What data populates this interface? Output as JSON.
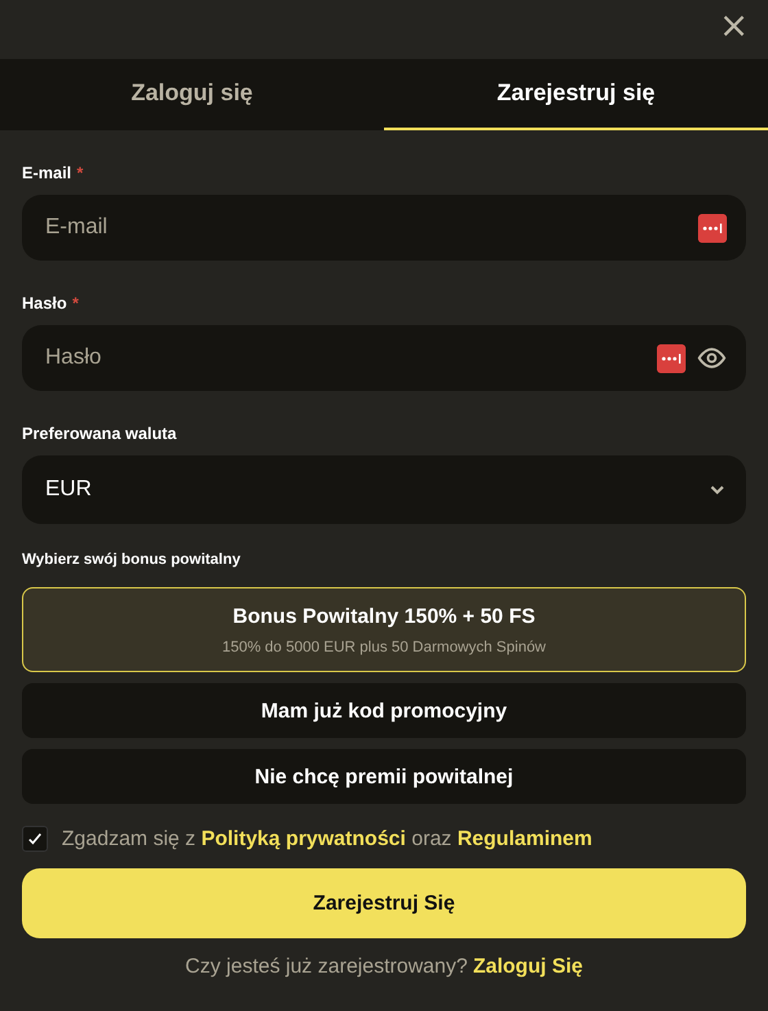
{
  "close_button": {
    "label": "×"
  },
  "tabs": [
    {
      "label": "Zaloguj się",
      "selected": false
    },
    {
      "label": "Zarejestruj się",
      "selected": true
    }
  ],
  "fields": [
    {
      "kind": "text",
      "label": "E-mail",
      "required_mark": "*",
      "placeholder": "E-mail"
    },
    {
      "kind": "password",
      "label": "Hasło",
      "required_mark": "*",
      "placeholder": "Hasło"
    },
    {
      "kind": "select",
      "label": "Preferowana waluta",
      "value": "EUR"
    }
  ],
  "bonus": {
    "label": "Wybierz swój bonus powitalny",
    "options": [
      {
        "title": "Bonus Powitalny 150% + 50 FS",
        "subtitle": "150% do 5000 EUR plus 50 Darmowych Spinów",
        "selected": true
      },
      {
        "title": "Mam już kod promocyjny",
        "selected": false
      },
      {
        "title": "Nie chcę premii powitalnej",
        "selected": false
      }
    ]
  },
  "consent": {
    "checked": true,
    "text_before": "Zgadzam się z",
    "link_1": "Polityką prywatności",
    "text_middle": "oraz",
    "link_2": "Regulaminem"
  },
  "submit_button": {
    "label": "Zarejestruj Się"
  },
  "footer": {
    "text": "Czy jesteś już zarejestrowany?",
    "link": "Zaloguj Się"
  }
}
